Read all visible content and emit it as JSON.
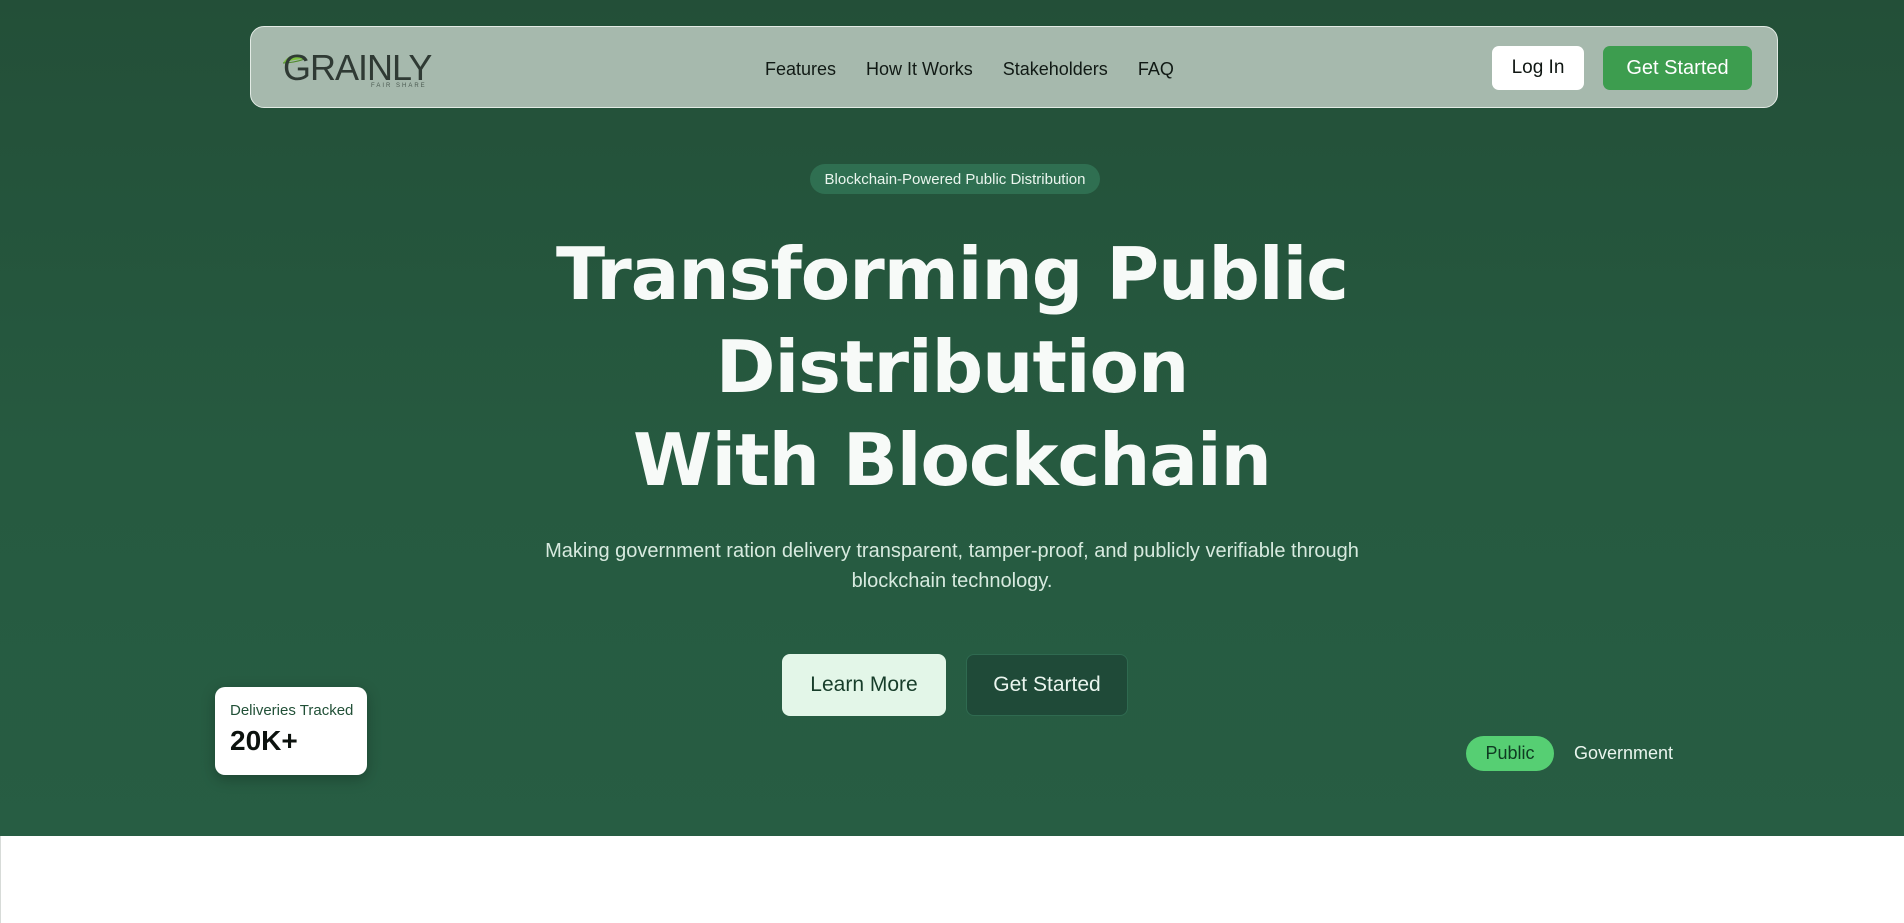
{
  "nav": {
    "logo_text": "GRAINLY",
    "logo_subtext": "FAIR SHARE",
    "links": [
      "Features",
      "How It Works",
      "Stakeholders",
      "FAQ"
    ],
    "login_label": "Log In",
    "get_started_label": "Get Started"
  },
  "hero": {
    "badge": "Blockchain-Powered Public Distribution",
    "headline_line1": "Transforming Public",
    "headline_line2": "Distribution",
    "headline_line3": "With Blockchain",
    "subtitle": "Making government ration delivery transparent, tamper-proof, and publicly verifiable through blockchain technology.",
    "learn_more_label": "Learn More",
    "get_started_label": "Get Started"
  },
  "stat_card": {
    "label": "Deliveries Tracked",
    "value": "20K+"
  },
  "toggle": {
    "public_label": "Public",
    "government_label": "Government"
  },
  "colors": {
    "hero_bg": "#265a40",
    "accent_green": "#3d9d4f",
    "toggle_active": "#56cf73"
  }
}
